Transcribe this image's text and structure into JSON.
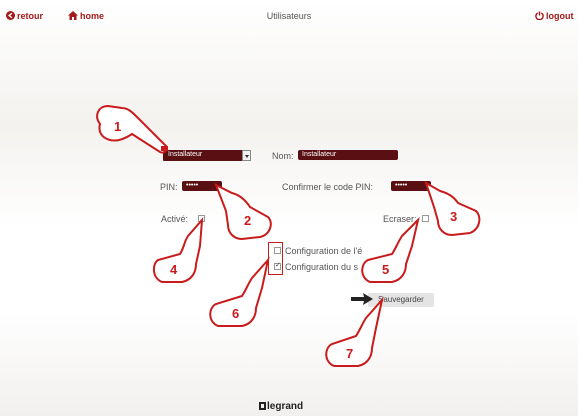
{
  "header": {
    "back_label": "retour",
    "home_label": "home",
    "title": "Utilisateurs",
    "logout_label": "logout"
  },
  "form": {
    "profile_value": "Installateur",
    "name_label": "Nom:",
    "name_value": "Installateur",
    "pin_label": "PIN:",
    "pin_value": "•••••",
    "confirm_pin_label": "Confirmer le code PIN:",
    "confirm_pin_value": "•••••",
    "active_label": "Activé:",
    "active_checked": false,
    "overwrite_label": "Ecraser:",
    "overwrite_checked": false,
    "config1_label": "Configuration de l'é",
    "config1_checked": false,
    "config2_label": "Configuration du s",
    "config2_checked": true,
    "save_label": "Sauvegarder"
  },
  "callouts": [
    "1",
    "2",
    "3",
    "4",
    "5",
    "6",
    "7"
  ],
  "brand": "legrand",
  "colors": {
    "accent": "#a31a1a",
    "field": "#5a0f12",
    "callout": "#c91b1b"
  }
}
